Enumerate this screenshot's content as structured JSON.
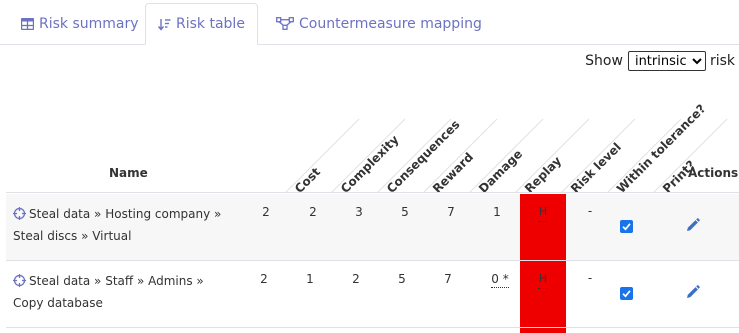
{
  "tabs": [
    {
      "label": "Risk summary",
      "icon": "table-icon",
      "active": false
    },
    {
      "label": "Risk table",
      "icon": "sort-icon",
      "active": true
    },
    {
      "label": "Countermeasure mapping",
      "icon": "mapping-icon",
      "active": false
    }
  ],
  "show": {
    "prefix": "Show",
    "selected": "intrinsic",
    "suffix": "risk"
  },
  "columns": {
    "name": "Name",
    "cost": "Cost",
    "complexity": "Complexity",
    "consequences": "Consequences",
    "reward": "Reward",
    "damage": "Damage",
    "replay": "Replay",
    "risk_level": "Risk level",
    "within_tolerance": "Within tolerance?",
    "print": "Print?",
    "actions": "Actions"
  },
  "rows": [
    {
      "name": "Steal data » Hosting company » Steal discs » Virtual",
      "cost": "2",
      "complexity": "2",
      "consequences": "3",
      "reward": "5",
      "damage": "7",
      "replay": "1",
      "risk_level": "H",
      "within_tolerance": "-",
      "print": true
    },
    {
      "name": "Steal data » Staff » Admins » Copy database",
      "cost": "2",
      "complexity": "1",
      "consequences": "2",
      "reward": "5",
      "damage": "7",
      "replay": "0 *",
      "risk_level": "H",
      "within_tolerance": "-",
      "print": true
    }
  ],
  "colors": {
    "accent": "#6c72c2",
    "risk_high": "#ee0000",
    "checkbox": "#1a73e8"
  }
}
